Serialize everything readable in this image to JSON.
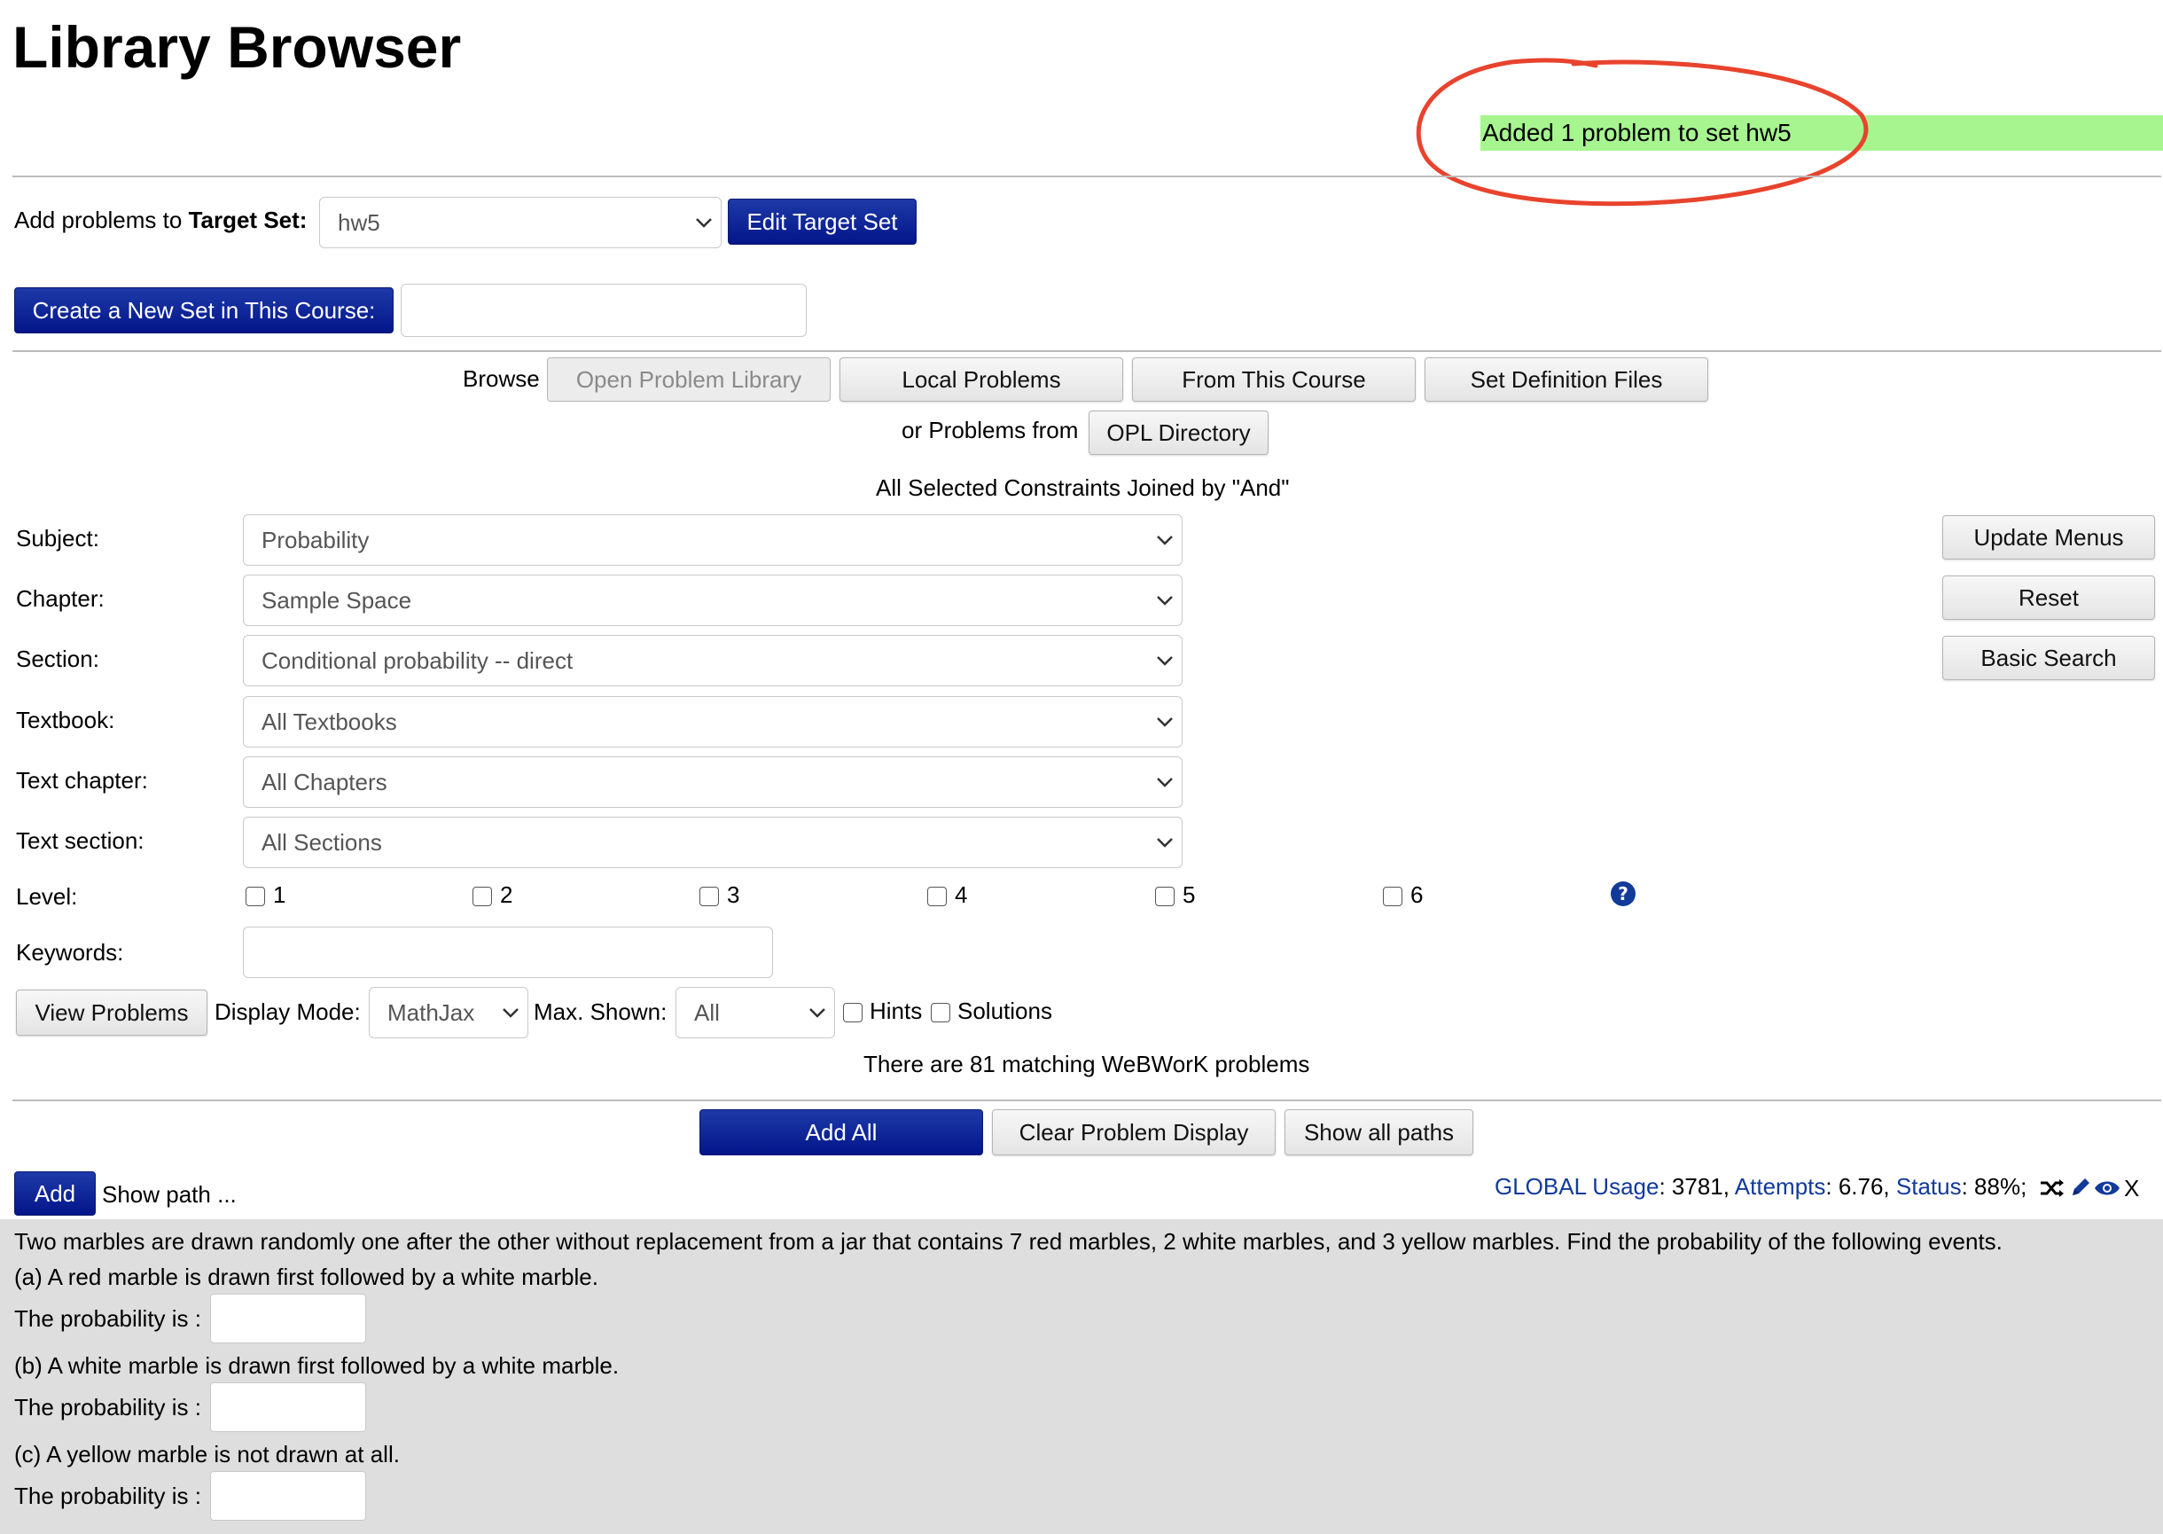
{
  "page": {
    "title": "Library Browser"
  },
  "status_message": "Added 1 problem to set hw5",
  "target": {
    "label_prefix": "Add problems to ",
    "label_bold": "Target Set:",
    "selected": "hw5",
    "edit_button": "Edit Target Set",
    "create_button": "Create a New Set in This Course:",
    "new_set_value": ""
  },
  "browse": {
    "label": "Browse",
    "tabs": [
      "Open Problem Library",
      "Local Problems",
      "From This Course",
      "Set Definition Files"
    ],
    "or_label": "or Problems from",
    "opl_directory_button": "OPL Directory",
    "constraints_note": "All Selected Constraints Joined by \"And\""
  },
  "filters": {
    "subject": {
      "label": "Subject:",
      "value": "Probability"
    },
    "chapter": {
      "label": "Chapter:",
      "value": "Sample Space"
    },
    "section": {
      "label": "Section:",
      "value": "Conditional probability -- direct"
    },
    "textbook": {
      "label": "Textbook:",
      "value": "All Textbooks"
    },
    "text_chapter": {
      "label": "Text chapter:",
      "value": "All Chapters"
    },
    "text_section": {
      "label": "Text section:",
      "value": "All Sections"
    },
    "level": {
      "label": "Level:",
      "options": [
        "1",
        "2",
        "3",
        "4",
        "5",
        "6"
      ]
    },
    "keywords": {
      "label": "Keywords:",
      "value": ""
    }
  },
  "side_buttons": {
    "update_menus": "Update Menus",
    "reset": "Reset",
    "basic_search": "Basic Search"
  },
  "view": {
    "view_button": "View Problems",
    "display_mode_label": "Display Mode:",
    "display_mode_value": "MathJax",
    "max_shown_label": "Max. Shown:",
    "max_shown_value": "All",
    "hints_label": "Hints",
    "solutions_label": "Solutions"
  },
  "match_count_text": "There are 81 matching WeBWorK problems",
  "actions": {
    "add_all": "Add All",
    "clear_display": "Clear Problem Display",
    "show_all_paths": "Show all paths"
  },
  "problem": {
    "add_button": "Add",
    "show_path": "Show path ...",
    "stats": {
      "global_usage_label": "GLOBAL Usage",
      "global_usage_value": ": 3781,",
      "attempts_label": "Attempts",
      "attempts_value": ": 6.76,",
      "status_label": "Status",
      "status_value": ": 88%;",
      "close": "X"
    },
    "statement": "Two marbles are drawn randomly one after the other without replacement from a jar that contains 7 red marbles, 2 white marbles, and 3 yellow marbles. Find the probability of the following events.",
    "parts": [
      {
        "question": "(a) A red marble is drawn first followed by a white marble.",
        "answer_label": "The probability is :",
        "answer": ""
      },
      {
        "question": "(b) A white marble is drawn first followed by a white marble.",
        "answer_label": "The probability is :",
        "answer": ""
      },
      {
        "question": "(c) A yellow marble is not drawn at all.",
        "answer_label": "The probability is :",
        "answer": ""
      }
    ]
  },
  "colors": {
    "primary_button": "#03158a",
    "success_bg": "#a6f58f",
    "annotation_circle": "#e8432d",
    "link": "#123a9a"
  }
}
